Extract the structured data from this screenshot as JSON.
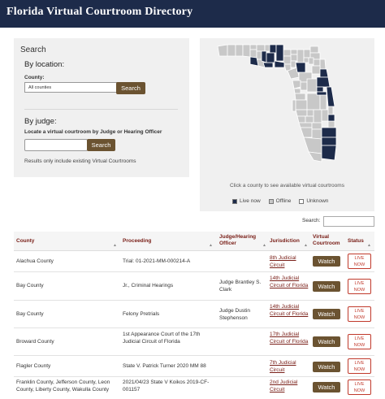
{
  "header": {
    "title": "Florida Virtual Courtroom Directory"
  },
  "search": {
    "title": "Search",
    "by_location": "By location:",
    "county_label": "County:",
    "county_selected": "All counties",
    "search_button": "Search",
    "by_judge": "By judge:",
    "judge_description": "Locate a virtual courtroom by Judge or Hearing Officer",
    "judge_button": "Search",
    "note": "Results only include existing Virtual Courtrooms"
  },
  "map": {
    "caption": "Click a county to see available virtual courtrooms",
    "legend": [
      {
        "label": "Live now",
        "color": "#1d2b4a"
      },
      {
        "label": "Offline",
        "color": "#c8c8c8"
      },
      {
        "label": "Unknown",
        "color": "#ffffff"
      }
    ]
  },
  "table": {
    "search_label": "Search:",
    "columns": [
      "County",
      "Proceeding",
      "Judge/Hearing Officer",
      "Jurisdiction",
      "Virtual Courtroom",
      "Status"
    ],
    "watch_label": "Watch",
    "status_label": "LIVE NOW",
    "rows": [
      {
        "county": "Alachua County",
        "proceeding": "Trial: 01-2021-MM-000214-A",
        "judge": "",
        "jurisdiction": "8th Judicial Circuit"
      },
      {
        "county": "Bay County",
        "proceeding": "Jr., Criminal Hearings",
        "judge": "Judge Brantley S. Clark",
        "jurisdiction": "14th Judicial Circuit of Florida"
      },
      {
        "county": "Bay County",
        "proceeding": "Felony Pretrials",
        "judge": "Judge Dustin Stephenson",
        "jurisdiction": "14th Judicial Circuit of Florida"
      },
      {
        "county": "Broward County",
        "proceeding": "1st Appearance Court of the 17th Judicial Circuit of Florida",
        "judge": "",
        "jurisdiction": "17th Judicial Circuit of Florida"
      },
      {
        "county": "Flagler County",
        "proceeding": "State V. Patrick Turner 2020 MM 88",
        "judge": "",
        "jurisdiction": "7th Judicial Circuit"
      },
      {
        "county": "Franklin County, Jefferson County, Leon County, Liberty County, Wakulla County",
        "proceeding": "2021/04/23 State V Koikos 2019-CF-001157",
        "judge": "",
        "jurisdiction": "2nd Judicial Circuit"
      }
    ]
  }
}
